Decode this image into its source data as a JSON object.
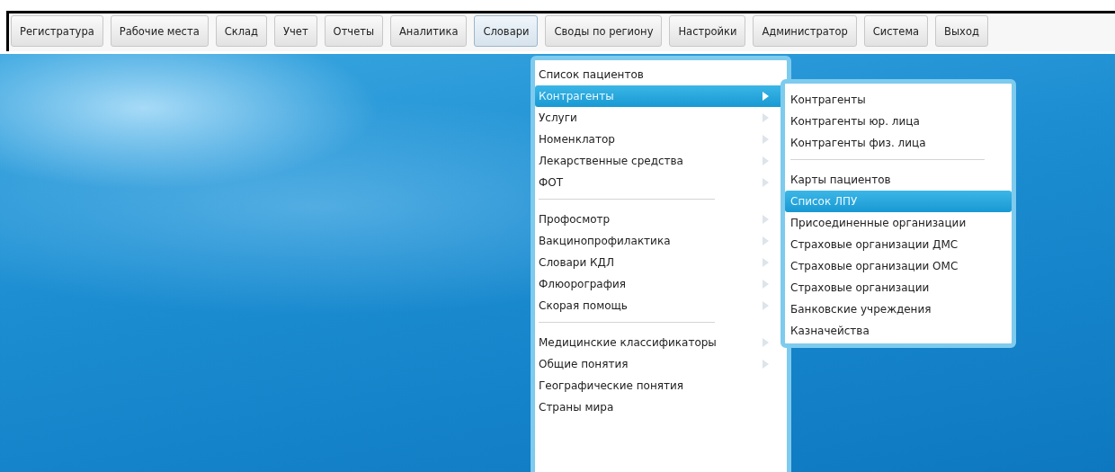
{
  "toolbar": [
    {
      "label": "Регистратура",
      "selected": false
    },
    {
      "label": "Рабочие места",
      "selected": false
    },
    {
      "label": "Склад",
      "selected": false
    },
    {
      "label": "Учет",
      "selected": false
    },
    {
      "label": "Отчеты",
      "selected": false
    },
    {
      "label": "Аналитика",
      "selected": false
    },
    {
      "label": "Словари",
      "selected": true
    },
    {
      "label": "Своды по региону",
      "selected": false
    },
    {
      "label": "Настройки",
      "selected": false
    },
    {
      "label": "Администратор",
      "selected": false
    },
    {
      "label": "Система",
      "selected": false
    },
    {
      "label": "Выход",
      "selected": false
    }
  ],
  "menu": {
    "items": [
      {
        "kind": "item",
        "label": "Список пациентов",
        "submenu": false,
        "selected": false
      },
      {
        "kind": "item",
        "label": "Контрагенты",
        "submenu": true,
        "selected": true
      },
      {
        "kind": "item",
        "label": "Услуги",
        "submenu": true,
        "selected": false
      },
      {
        "kind": "item",
        "label": "Номенклатор",
        "submenu": true,
        "selected": false
      },
      {
        "kind": "item",
        "label": "Лекарственные средства",
        "submenu": true,
        "selected": false
      },
      {
        "kind": "item",
        "label": "ФОТ",
        "submenu": true,
        "selected": false
      },
      {
        "kind": "separator"
      },
      {
        "kind": "item",
        "label": "Профосмотр",
        "submenu": true,
        "selected": false
      },
      {
        "kind": "item",
        "label": "Вакцинопрофилактика",
        "submenu": true,
        "selected": false
      },
      {
        "kind": "item",
        "label": "Словари КДЛ",
        "submenu": true,
        "selected": false
      },
      {
        "kind": "item",
        "label": "Флюорография",
        "submenu": true,
        "selected": false
      },
      {
        "kind": "item",
        "label": "Скорая помощь",
        "submenu": true,
        "selected": false
      },
      {
        "kind": "separator"
      },
      {
        "kind": "item",
        "label": "Медицинские классификаторы",
        "submenu": true,
        "selected": false
      },
      {
        "kind": "item",
        "label": "Общие понятия",
        "submenu": true,
        "selected": false
      },
      {
        "kind": "item",
        "label": "Географические понятия",
        "submenu": false,
        "selected": false
      },
      {
        "kind": "item",
        "label": "Страны мира",
        "submenu": false,
        "selected": false
      }
    ]
  },
  "submenu": {
    "items": [
      {
        "kind": "item",
        "label": "Контрагенты",
        "selected": false
      },
      {
        "kind": "item",
        "label": "Контрагенты юр. лица",
        "selected": false
      },
      {
        "kind": "item",
        "label": "Контрагенты физ. лица",
        "selected": false
      },
      {
        "kind": "separator"
      },
      {
        "kind": "item",
        "label": "Карты пациентов",
        "selected": false
      },
      {
        "kind": "item",
        "label": "Список ЛПУ",
        "selected": true
      },
      {
        "kind": "item",
        "label": "Присоединенные организации",
        "selected": false
      },
      {
        "kind": "item",
        "label": "Страховые организации ДМС",
        "selected": false
      },
      {
        "kind": "item",
        "label": "Страховые организации ОМС",
        "selected": false
      },
      {
        "kind": "item",
        "label": "Страховые организации",
        "selected": false
      },
      {
        "kind": "item",
        "label": "Банковские учреждения",
        "selected": false
      },
      {
        "kind": "item",
        "label": "Казначейства",
        "selected": false
      }
    ]
  }
}
